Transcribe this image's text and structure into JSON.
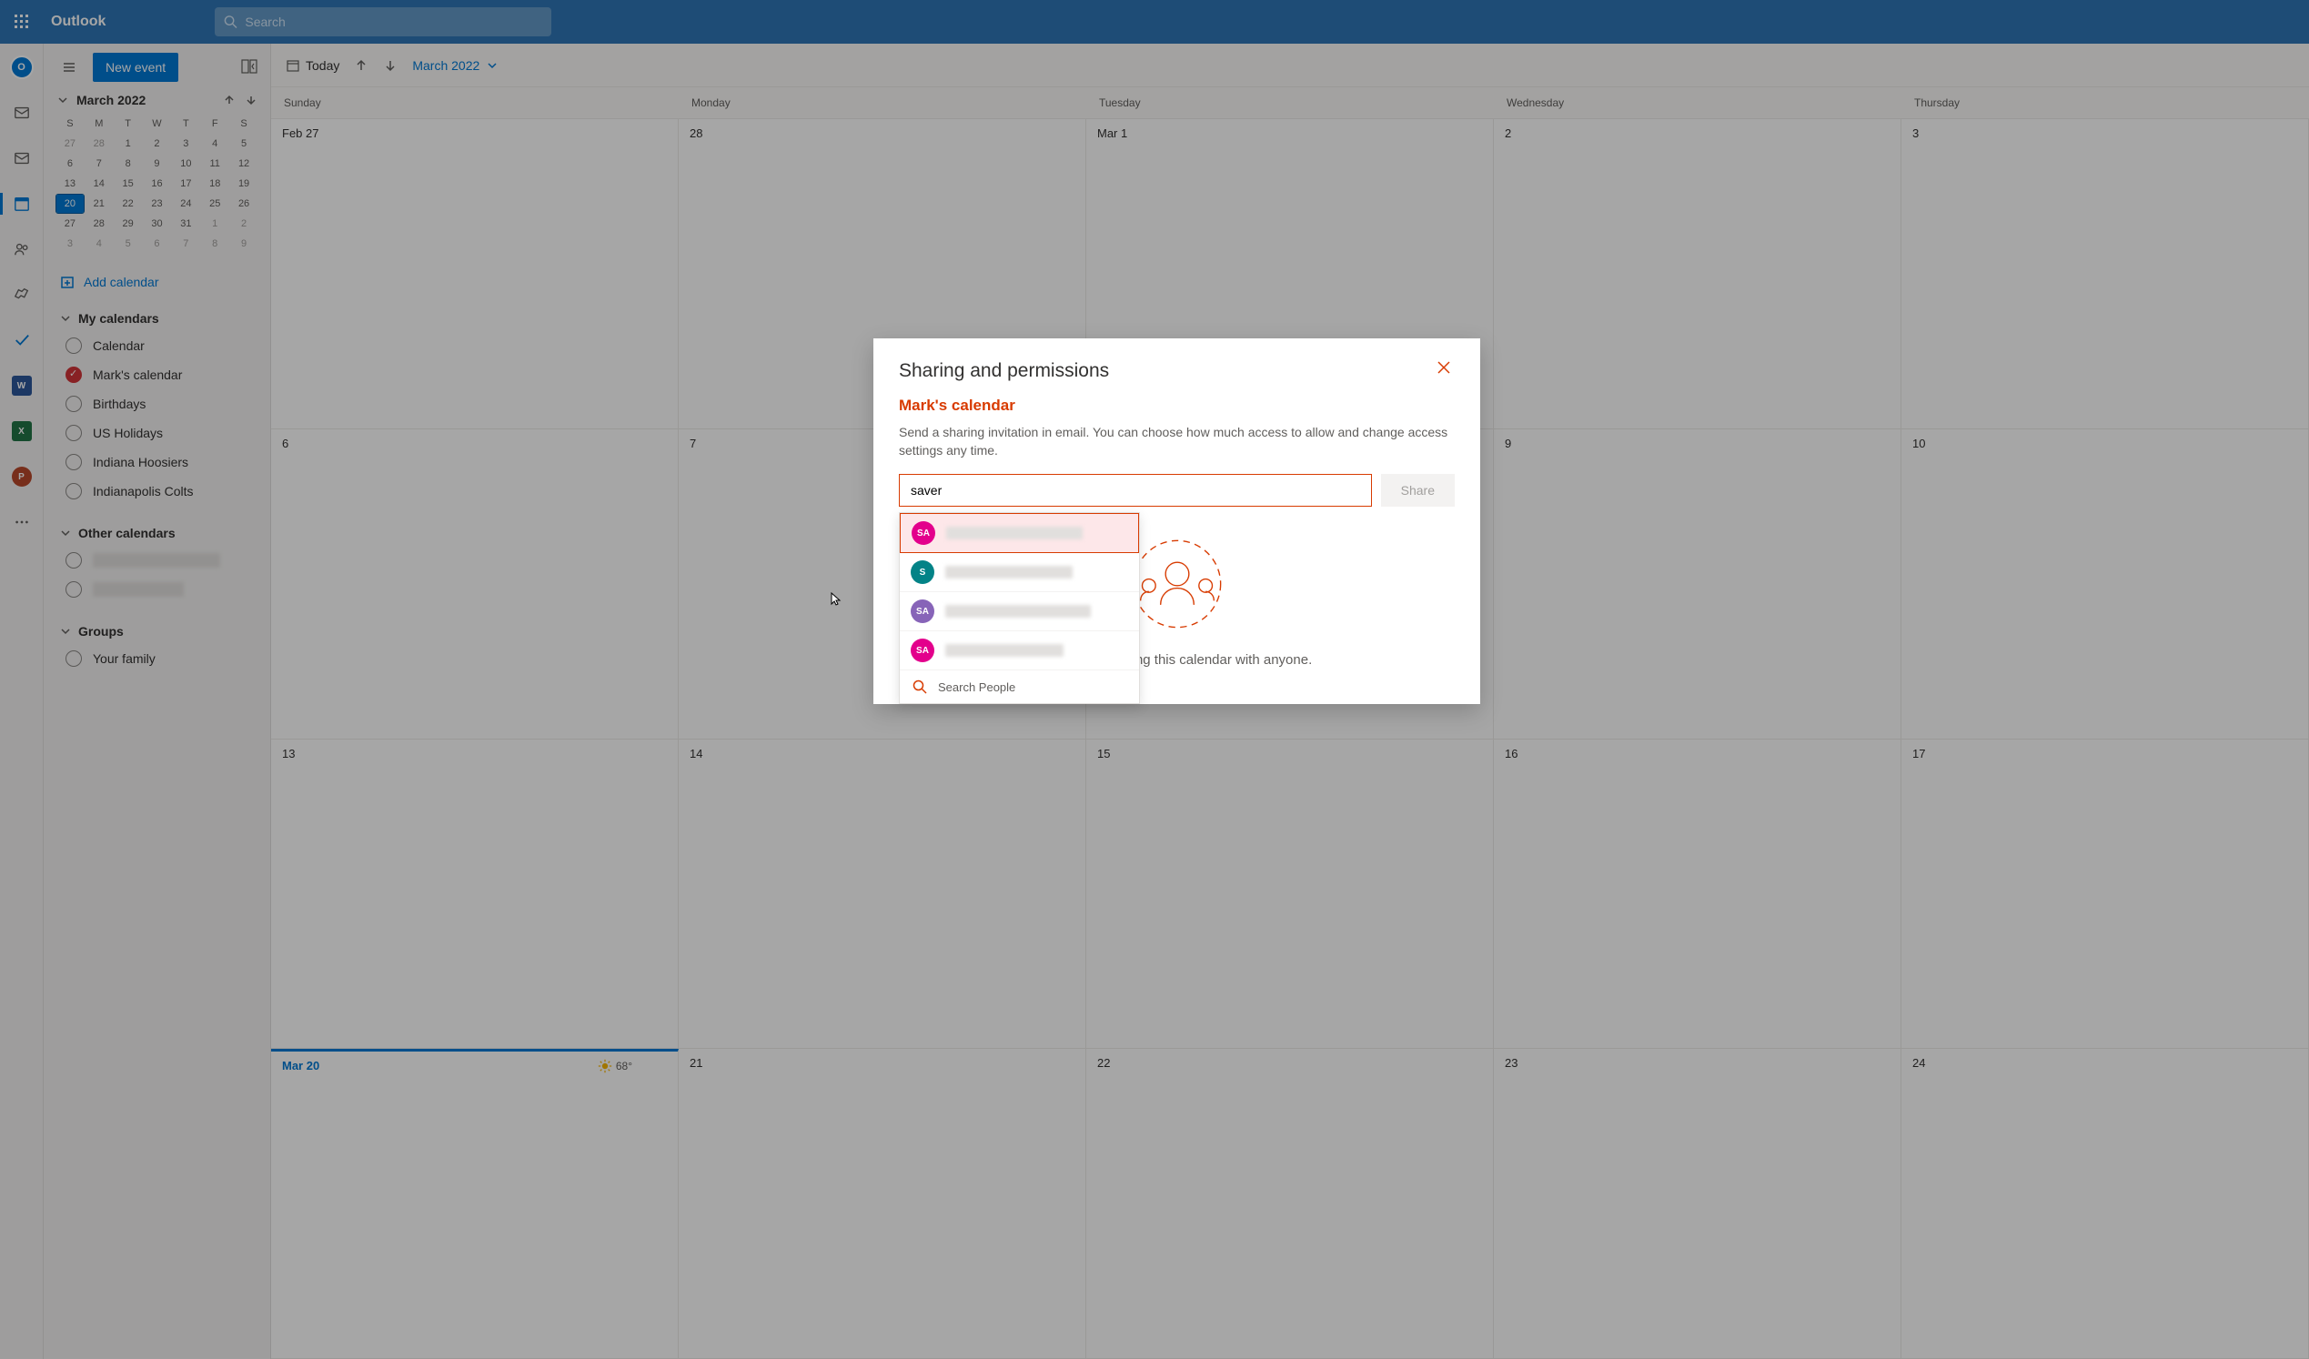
{
  "header": {
    "app_name": "Outlook",
    "search_placeholder": "Search"
  },
  "sidebar": {
    "new_event_label": "New event",
    "mini_cal_title": "March 2022",
    "mini_cal_dow": [
      "S",
      "M",
      "T",
      "W",
      "T",
      "F",
      "S"
    ],
    "mini_cal_days": [
      {
        "d": "27",
        "dim": true
      },
      {
        "d": "28",
        "dim": true
      },
      {
        "d": "1"
      },
      {
        "d": "2"
      },
      {
        "d": "3"
      },
      {
        "d": "4"
      },
      {
        "d": "5"
      },
      {
        "d": "6"
      },
      {
        "d": "7"
      },
      {
        "d": "8"
      },
      {
        "d": "9"
      },
      {
        "d": "10"
      },
      {
        "d": "11"
      },
      {
        "d": "12"
      },
      {
        "d": "13"
      },
      {
        "d": "14"
      },
      {
        "d": "15"
      },
      {
        "d": "16"
      },
      {
        "d": "17"
      },
      {
        "d": "18"
      },
      {
        "d": "19"
      },
      {
        "d": "20",
        "today": true
      },
      {
        "d": "21"
      },
      {
        "d": "22"
      },
      {
        "d": "23"
      },
      {
        "d": "24"
      },
      {
        "d": "25"
      },
      {
        "d": "26"
      },
      {
        "d": "27"
      },
      {
        "d": "28"
      },
      {
        "d": "29"
      },
      {
        "d": "30"
      },
      {
        "d": "31"
      },
      {
        "d": "1",
        "dim": true
      },
      {
        "d": "2",
        "dim": true
      },
      {
        "d": "3",
        "dim": true
      },
      {
        "d": "4",
        "dim": true
      },
      {
        "d": "5",
        "dim": true
      },
      {
        "d": "6",
        "dim": true
      },
      {
        "d": "7",
        "dim": true
      },
      {
        "d": "8",
        "dim": true
      },
      {
        "d": "9",
        "dim": true
      }
    ],
    "add_calendar_label": "Add calendar",
    "my_calendars_label": "My calendars",
    "my_calendars": [
      {
        "label": "Calendar",
        "checked": false
      },
      {
        "label": "Mark's calendar",
        "checked": true
      },
      {
        "label": "Birthdays",
        "checked": false
      },
      {
        "label": "US Holidays",
        "checked": false
      },
      {
        "label": "Indiana Hoosiers",
        "checked": false
      },
      {
        "label": "Indianapolis Colts",
        "checked": false
      }
    ],
    "other_calendars_label": "Other calendars",
    "groups_label": "Groups",
    "groups": [
      {
        "label": "Your family",
        "checked": false
      }
    ]
  },
  "toolbar": {
    "today_label": "Today",
    "month_display": "March 2022"
  },
  "calendar": {
    "dow": [
      "Sunday",
      "Monday",
      "Tuesday",
      "Wednesday",
      "Thursday"
    ],
    "weeks": [
      [
        {
          "label": "Feb 27"
        },
        {
          "label": "28"
        },
        {
          "label": "Mar 1"
        },
        {
          "label": "2"
        },
        {
          "label": "3"
        }
      ],
      [
        {
          "label": "6"
        },
        {
          "label": "7"
        },
        {
          "label": "8"
        },
        {
          "label": "9"
        },
        {
          "label": "10"
        }
      ],
      [
        {
          "label": "13"
        },
        {
          "label": "14"
        },
        {
          "label": "15"
        },
        {
          "label": "16"
        },
        {
          "label": "17"
        }
      ],
      [
        {
          "label": "Mar 20",
          "current": true,
          "temp": "68°"
        },
        {
          "label": "21",
          "weather": true
        },
        {
          "label": "22",
          "weather": true
        },
        {
          "label": "23",
          "weather": true
        },
        {
          "label": "24",
          "weather": true
        }
      ]
    ]
  },
  "modal": {
    "title": "Sharing and permissions",
    "calendar_name": "Mark's calendar",
    "description": "Send a sharing invitation in email. You can choose how much access to allow and change access settings any time.",
    "input_value": "saver",
    "share_label": "Share",
    "not_sharing_text": "You're not sharing this calendar with anyone.",
    "suggestions": [
      {
        "initials": "SA",
        "color": "#e3008c",
        "highlighted": true,
        "blur_width": 150
      },
      {
        "initials": "S",
        "color": "#038387",
        "blur_width": 140
      },
      {
        "initials": "SA",
        "color": "#8764b8",
        "blur_width": 160
      },
      {
        "initials": "SA",
        "color": "#e3008c",
        "blur_width": 130
      }
    ],
    "search_people_label": "Search People"
  }
}
